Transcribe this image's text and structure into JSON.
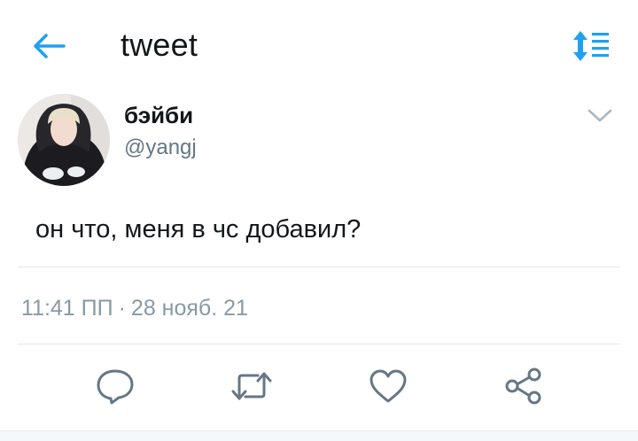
{
  "header": {
    "title": "tweet",
    "back_icon": "back-arrow-icon",
    "sort_icon": "sort-list-icon",
    "accent_color": "#1da1f2"
  },
  "tweet": {
    "author": {
      "display_name": "бэйби",
      "handle": "@yangj"
    },
    "text": "он что, меня в чс добавил?",
    "time": "11:41 ПП",
    "separator": "·",
    "date": "28 нояб. 21"
  },
  "actions": [
    {
      "name": "reply",
      "icon": "reply-bubble-icon"
    },
    {
      "name": "retweet",
      "icon": "retweet-icon"
    },
    {
      "name": "like",
      "icon": "heart-icon"
    },
    {
      "name": "share",
      "icon": "share-icon"
    }
  ]
}
